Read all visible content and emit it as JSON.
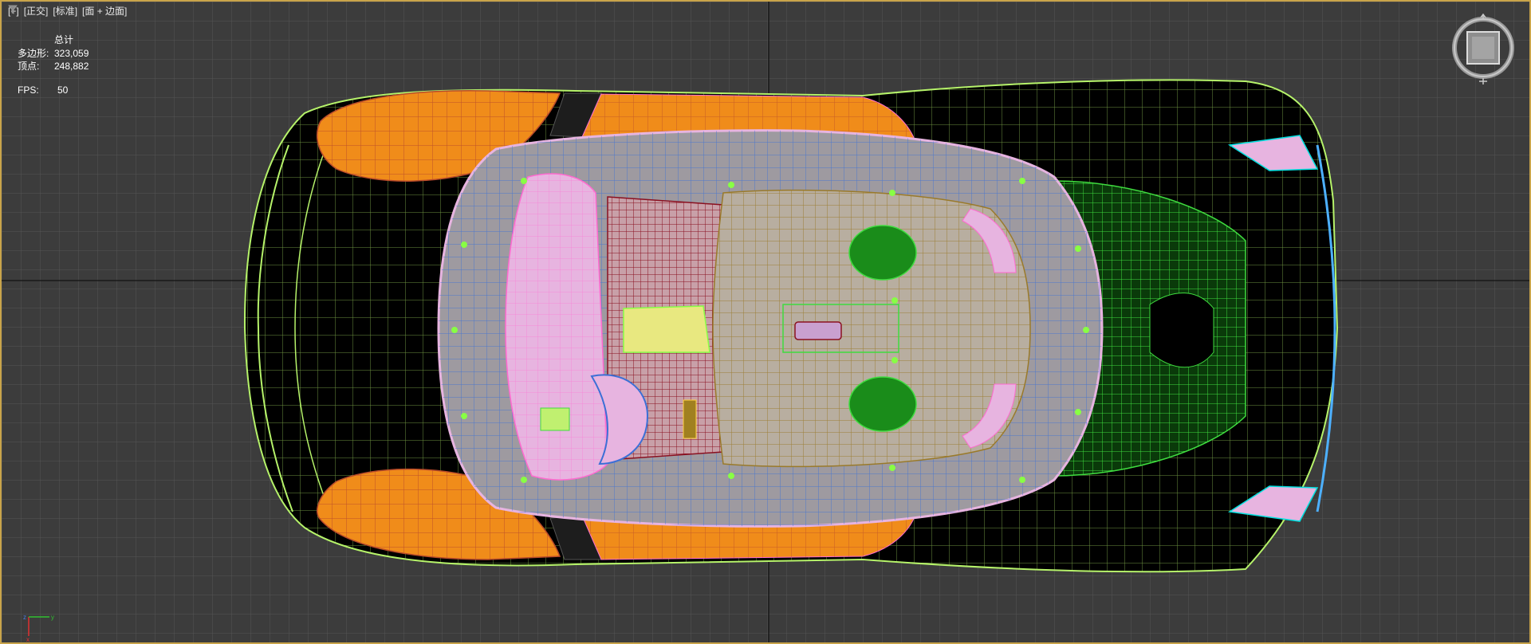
{
  "viewport": {
    "menu": {
      "plus": "[+]",
      "view": "[正交]",
      "shading_style": "[标准]",
      "display_mode": "[面 + 边面]"
    },
    "stats": {
      "title": "总计",
      "polygons_label": "多边形:",
      "polygons_value": "323,059",
      "vertices_label": "顶点:",
      "vertices_value": "248,882",
      "fps_label": "FPS:",
      "fps_value": "50"
    },
    "icons": {
      "filter": "filter-icon",
      "viewcube": "viewcube-icon",
      "axis": "axis-tripod-icon"
    },
    "colors": {
      "background": "#3c3c3c",
      "grid": "#5a5a5a",
      "border": "#c9a44a",
      "body_orange": "#f08c1a",
      "wire_green": "#b6f36a",
      "glass_grey": "#9e9aa0",
      "interior_pink": "#e7b4e0",
      "engine_green": "#1a8c1a"
    }
  }
}
